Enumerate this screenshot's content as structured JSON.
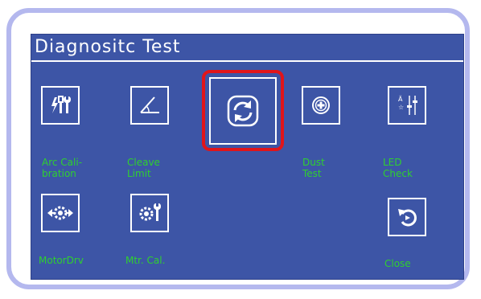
{
  "title": "Diagnositc Test",
  "buttons": {
    "arc_calibration": {
      "icon": "tools-icon",
      "label": "Arc Cali-\nbration"
    },
    "cleave_limit": {
      "icon": "angle-icon",
      "label": "Cleave\nLimit"
    },
    "refresh": {
      "icon": "refresh-icon"
    },
    "dust_test": {
      "icon": "plus-circle-icon",
      "label": "Dust\nTest"
    },
    "led_check": {
      "icon": "sliders-icon",
      "label": "LED\nCheck"
    },
    "motor_drv": {
      "icon": "gear-arrows-icon",
      "label": "MotorDrv"
    },
    "mtr_cal": {
      "icon": "gear-wrench-icon",
      "label": "Mtr. Cal."
    },
    "close": {
      "icon": "undo-icon",
      "label": "Close"
    }
  },
  "colors": {
    "screen_bg": "#3d55a6",
    "label_green": "#2fd02f",
    "highlight_red": "#e0151a",
    "frame": "#b4b8ee"
  }
}
